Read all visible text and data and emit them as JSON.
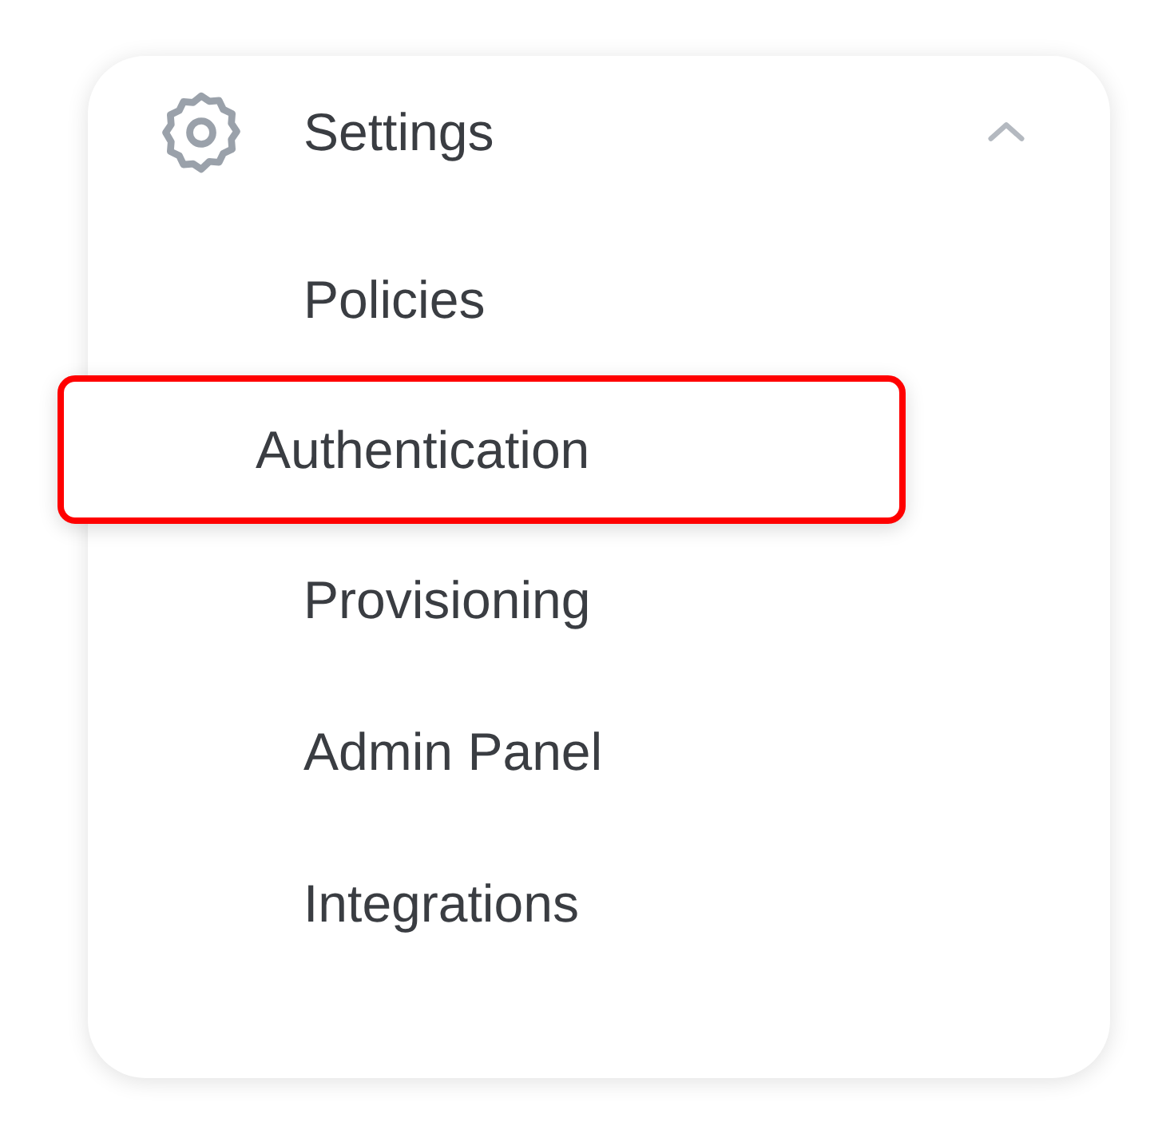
{
  "menu": {
    "title": "Settings",
    "expanded": true,
    "items": [
      {
        "label": "Policies",
        "selected": false
      },
      {
        "label": "Authentication",
        "selected": true
      },
      {
        "label": "Provisioning",
        "selected": false
      },
      {
        "label": "Admin Panel",
        "selected": false
      },
      {
        "label": "Integrations",
        "selected": false
      }
    ]
  }
}
